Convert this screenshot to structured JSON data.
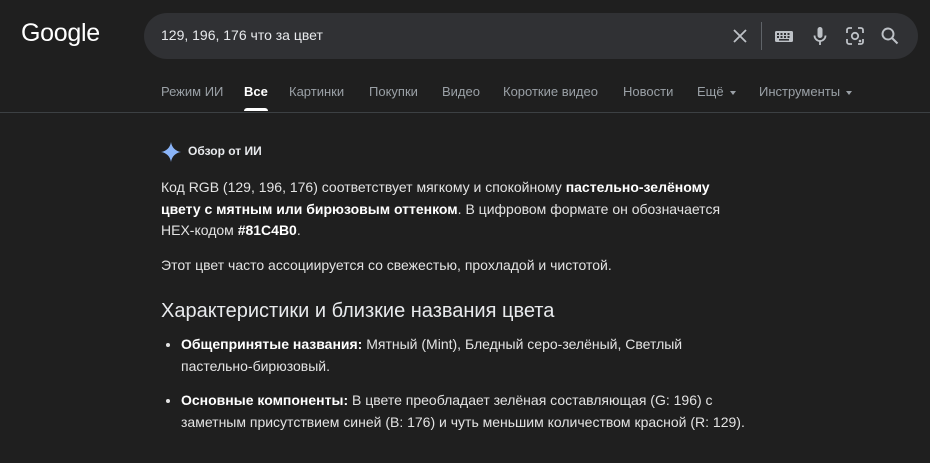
{
  "logo": "Google",
  "search": {
    "query": "129, 196, 176 что за цвет",
    "icons": [
      "close-icon",
      "keyboard-icon",
      "microphone-icon",
      "lens-icon",
      "search-icon"
    ]
  },
  "tabs": [
    {
      "label": "Режим ИИ",
      "active": false
    },
    {
      "label": "Все",
      "active": true
    },
    {
      "label": "Картинки",
      "active": false
    },
    {
      "label": "Покупки",
      "active": false
    },
    {
      "label": "Видео",
      "active": false
    },
    {
      "label": "Короткие видео",
      "active": false
    },
    {
      "label": "Новости",
      "active": false
    },
    {
      "label": "Ещё",
      "active": false,
      "dropdown": true
    },
    {
      "label": "Инструменты",
      "active": false,
      "dropdown": true
    }
  ],
  "overview": {
    "title": "Обзор от ИИ",
    "p1": {
      "t1": "Код RGB (129, 196, 176) соответствует мягкому и спокойному ",
      "b1": "пастельно-зелёному цвету с мятным или бирюзовым оттенком",
      "t2": ". В цифровом формате он обозначается HEX-кодом ",
      "b2": "#81C4B0",
      "t3": "."
    },
    "p2": "Этот цвет часто ассоциируется со свежестью, прохладой и чистотой.",
    "heading": "Характеристики и близкие названия цвета",
    "bullets": [
      {
        "label": "Общепринятые названия:",
        "text": " Мятный (Mint), Бледный серо-зелёный, Светлый пастельно-бирюзовый."
      },
      {
        "label": "Основные компоненты:",
        "text": " В цвете преобладает зелёная составляющая (G: 196) с заметным присутствием синей (B: 176) и чуть меньшим количеством красной (R: 129)."
      }
    ]
  },
  "colors": {
    "background": "#1f1f1f",
    "searchbox": "#303134",
    "star_blue": "#8ab4f8"
  }
}
